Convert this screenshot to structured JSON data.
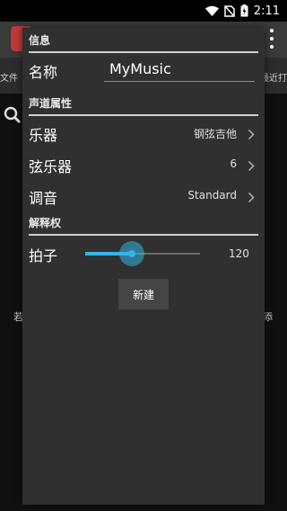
{
  "status_bar": {
    "time": "2:11",
    "icons": [
      "wifi-icon",
      "no-sim-icon",
      "battery-charging-icon"
    ]
  },
  "background": {
    "tab_left": "文件",
    "tab_right": "最近打",
    "text_left": "若",
    "text_right": "添",
    "icons": [
      "app-logo-icon",
      "overflow-menu-icon",
      "search-icon"
    ]
  },
  "dialog": {
    "sections": {
      "info": "信息",
      "track_props": "声道属性",
      "interpretation": "解释权"
    },
    "name": {
      "label": "名称",
      "value": "MyMusic"
    },
    "prefs": [
      {
        "title": "乐器",
        "value": "钢弦吉他"
      },
      {
        "title": "弦乐器",
        "value": "6"
      },
      {
        "title": "调音",
        "value": "Standard"
      }
    ],
    "tempo": {
      "label": "拍子",
      "value": "120",
      "slider_fraction": 0.41
    },
    "create_button": "新建"
  },
  "colors": {
    "accent": "#33b5e5",
    "dialog_bg": "#303030",
    "toolbar_bg": "#3a3a3a",
    "logo_red": "#c23a38"
  }
}
